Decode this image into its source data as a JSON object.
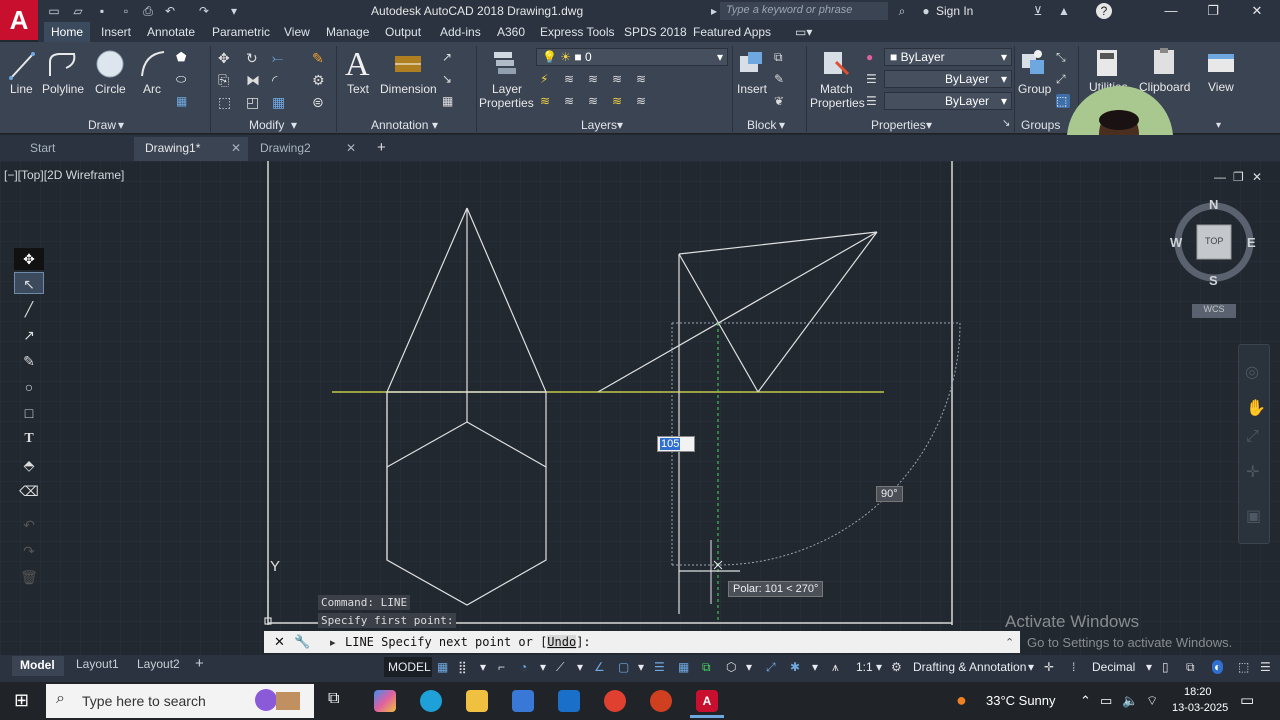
{
  "window": {
    "title": "Autodesk AutoCAD 2018   Drawing1.dwg",
    "search_placeholder": "Type a keyword or phrase",
    "signin": "Sign In",
    "logo": "A"
  },
  "ribbon_tabs": [
    "Home",
    "Insert",
    "Annotate",
    "Parametric",
    "View",
    "Manage",
    "Output",
    "Add-ins",
    "A360",
    "Express Tools",
    "SPDS 2018",
    "Featured Apps"
  ],
  "ribbon": {
    "draw": {
      "title": "Draw",
      "line": "Line",
      "polyline": "Polyline",
      "circle": "Circle",
      "arc": "Arc"
    },
    "modify": {
      "title": "Modify"
    },
    "annotation": {
      "title": "Annotation",
      "text": "Text",
      "dimension": "Dimension"
    },
    "layers": {
      "title": "Layers",
      "layer_properties_1": "Layer",
      "layer_properties_2": "Properties",
      "current_layer": "0"
    },
    "block": {
      "title": "Block",
      "insert": "Insert"
    },
    "properties": {
      "title": "Properties",
      "match_1": "Match",
      "match_2": "Properties",
      "color": "ByLayer",
      "linetype": "ByLayer",
      "lineweight": "ByLayer"
    },
    "groups": {
      "title": "Groups",
      "group": "Group"
    },
    "utilities": "Utilities",
    "clipboard": "Clipboard",
    "view": "View"
  },
  "file_tabs": {
    "start": "Start",
    "drawing1": "Drawing1*",
    "drawing2": "Drawing2",
    "close": "✕",
    "add": "+"
  },
  "viewport": {
    "label": "[−][Top][2D Wireframe]",
    "viewcube": {
      "n": "N",
      "s": "S",
      "e": "E",
      "w": "W",
      "face": "TOP",
      "wcs": "WCS"
    },
    "ucs_y": "Y",
    "dynamic_input": "105",
    "angle_tip": "90°",
    "polar_tip": "Polar: 101 < 270°"
  },
  "command": {
    "history1": "Command:  LINE",
    "history2": "Specify first point:",
    "prompt": "LINE Specify next point or [",
    "option": "Undo",
    "prompt_end": "]:"
  },
  "status": {
    "tab_model": "Model",
    "tab_layout1": "Layout1",
    "tab_layout2": "Layout2",
    "model": "MODEL",
    "scale": "1:1",
    "workspace": "Drafting & Annotation",
    "units": "Decimal"
  },
  "watermark": {
    "line1": "Activate Windows",
    "line2": "Go to Settings to activate Windows."
  },
  "taskbar": {
    "search_placeholder": "Type here to search",
    "weather": "33°C  Sunny",
    "time": "18:20",
    "date": "13-03-2025"
  }
}
